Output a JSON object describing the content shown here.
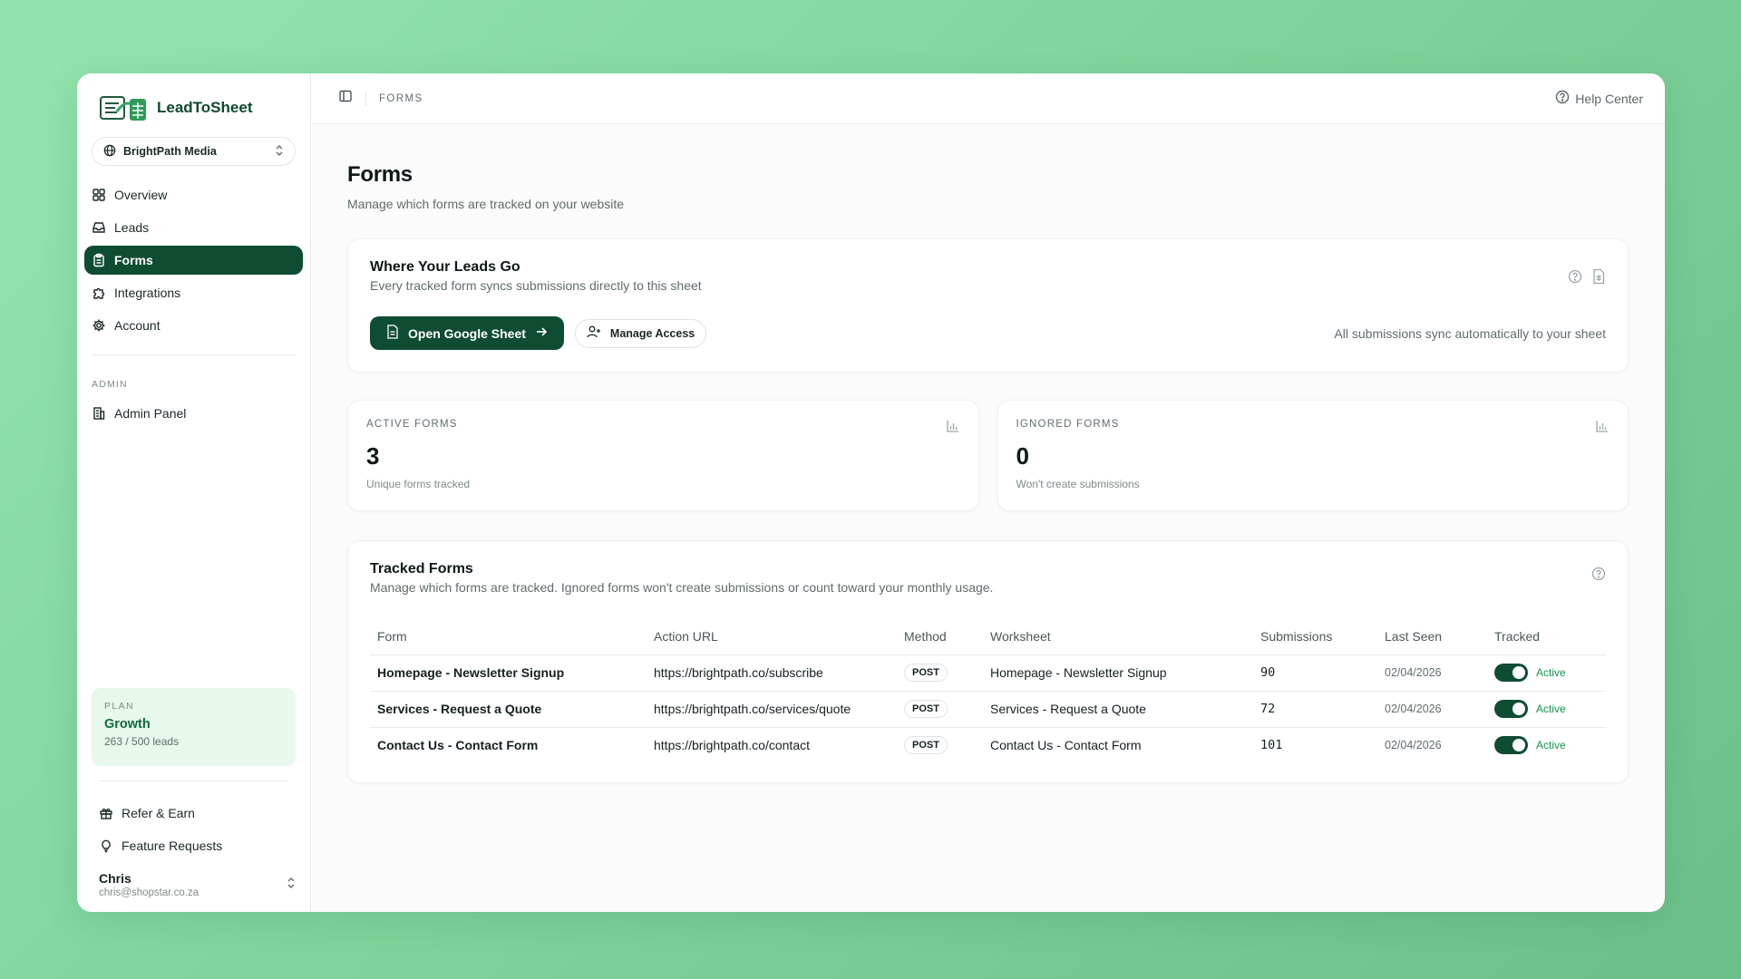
{
  "app": {
    "name": "LeadToSheet"
  },
  "workspace": {
    "name": "BrightPath Media"
  },
  "sidebar": {
    "items": [
      {
        "label": "Overview"
      },
      {
        "label": "Leads"
      },
      {
        "label": "Forms"
      },
      {
        "label": "Integrations"
      },
      {
        "label": "Account"
      }
    ],
    "admin_section": "ADMIN",
    "admin_items": [
      {
        "label": "Admin Panel"
      }
    ],
    "plan": {
      "label": "PLAN",
      "name": "Growth",
      "usage": "263 / 500 leads"
    },
    "bottom_items": [
      {
        "label": "Refer & Earn"
      },
      {
        "label": "Feature Requests"
      }
    ],
    "user": {
      "name": "Chris",
      "email": "chris@shopstar.co.za"
    }
  },
  "topbar": {
    "breadcrumb": "FORMS",
    "help": "Help Center"
  },
  "page": {
    "title": "Forms",
    "subtitle": "Manage which forms are tracked on your website"
  },
  "leads_card": {
    "title": "Where Your Leads Go",
    "subtitle": "Every tracked form syncs submissions directly to this sheet",
    "open_button": "Open Google Sheet",
    "manage_button": "Manage Access",
    "sync_note": "All submissions sync automatically to your sheet"
  },
  "stats": {
    "active": {
      "label": "ACTIVE FORMS",
      "value": "3",
      "desc": "Unique forms tracked"
    },
    "ignored": {
      "label": "IGNORED FORMS",
      "value": "0",
      "desc": "Won't create submissions"
    }
  },
  "tracked": {
    "title": "Tracked Forms",
    "subtitle": "Manage which forms are tracked. Ignored forms won't create submissions or count toward your monthly usage.",
    "columns": [
      "Form",
      "Action URL",
      "Method",
      "Worksheet",
      "Submissions",
      "Last Seen",
      "Tracked"
    ],
    "rows": [
      {
        "form": "Homepage - Newsletter Signup",
        "url": "https://brightpath.co/subscribe",
        "method": "POST",
        "worksheet": "Homepage - Newsletter Signup",
        "submissions": "90",
        "last_seen": "02/04/2026",
        "status": "Active"
      },
      {
        "form": "Services - Request a Quote",
        "url": "https://brightpath.co/services/quote",
        "method": "POST",
        "worksheet": "Services - Request a Quote",
        "submissions": "72",
        "last_seen": "02/04/2026",
        "status": "Active"
      },
      {
        "form": "Contact Us - Contact Form",
        "url": "https://brightpath.co/contact",
        "method": "POST",
        "worksheet": "Contact Us - Contact Form",
        "submissions": "101",
        "last_seen": "02/04/2026",
        "status": "Active"
      }
    ]
  },
  "colors": {
    "brand": "#0f4d32",
    "accent_green": "#15924a",
    "plan_bg": "#e7f8ec"
  }
}
